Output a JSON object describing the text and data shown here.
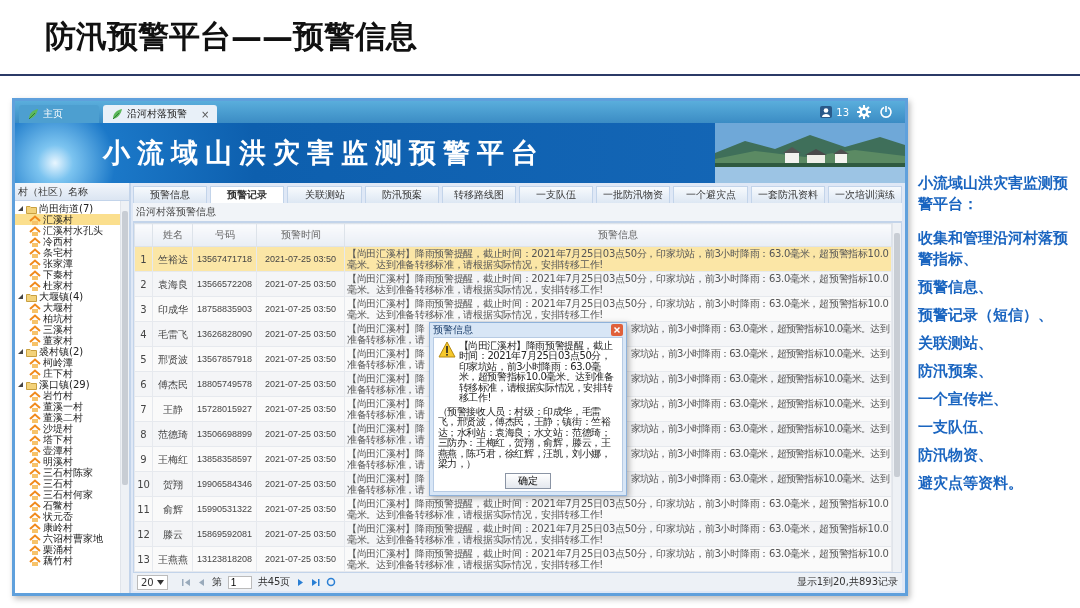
{
  "slide": {
    "title": "防汛预警平台——预警信息",
    "notes": [
      "小流域山洪灾害监测预警平台：",
      "收集和管理沿河村落预警指标、",
      "预警信息、",
      "预警记录（短信）、",
      "关联测站、",
      "防汛预案、",
      "一个宣传栏、",
      "一支队伍、",
      "防汛物资、",
      "避灾点等资料。"
    ]
  },
  "app": {
    "tabs": [
      {
        "label": "主页",
        "selected": false
      },
      {
        "label": "沿河村落预警",
        "selected": true,
        "close": "×"
      }
    ],
    "user_count": "13",
    "banner_title": "小流域山洪灾害监测预警平台",
    "tree": {
      "header": "村（社区）名称",
      "groups": [
        {
          "label": "尚田街道(7)",
          "expanded": true,
          "children": [
            {
              "label": "汇溪村",
              "selected": true
            },
            {
              "label": "汇溪村水孔头",
              "selected": false
            },
            {
              "label": "冷西村",
              "selected": false
            },
            {
              "label": "条宅村",
              "selected": false
            },
            {
              "label": "张家潭",
              "selected": false
            },
            {
              "label": "下秦村",
              "selected": false
            },
            {
              "label": "杜家村",
              "selected": false
            }
          ]
        },
        {
          "label": "大堰镇(4)",
          "expanded": true,
          "children": [
            {
              "label": "大堰村",
              "selected": false
            },
            {
              "label": "柏坑村",
              "selected": false
            },
            {
              "label": "三溪村",
              "selected": false
            },
            {
              "label": "董家村",
              "selected": false
            }
          ]
        },
        {
          "label": "裘村镇(2)",
          "expanded": true,
          "children": [
            {
              "label": "柯岭潭",
              "selected": false
            },
            {
              "label": "庄下村",
              "selected": false
            }
          ]
        },
        {
          "label": "溪口镇(29)",
          "expanded": true,
          "children": [
            {
              "label": "岩竹村",
              "selected": false
            },
            {
              "label": "董溪一村",
              "selected": false
            },
            {
              "label": "董溪二村",
              "selected": false
            },
            {
              "label": "沙堤村",
              "selected": false
            },
            {
              "label": "塔下村",
              "selected": false
            },
            {
              "label": "壶潭村",
              "selected": false
            },
            {
              "label": "明溪村",
              "selected": false
            },
            {
              "label": "三石村陈家",
              "selected": false
            },
            {
              "label": "三石村",
              "selected": false
            },
            {
              "label": "三石村何家",
              "selected": false
            },
            {
              "label": "石鳖村",
              "selected": false
            },
            {
              "label": "状元岙",
              "selected": false
            },
            {
              "label": "康岭村",
              "selected": false
            },
            {
              "label": "六诏村曹家地",
              "selected": false
            },
            {
              "label": "栗涌村",
              "selected": false
            },
            {
              "label": "藕竹村",
              "selected": false
            }
          ]
        }
      ]
    },
    "content_tabs": [
      {
        "label": "预警信息",
        "selected": false
      },
      {
        "label": "预警记录",
        "selected": true
      },
      {
        "label": "关联测站",
        "selected": false
      },
      {
        "label": "防汛预案",
        "selected": false
      },
      {
        "label": "转移路线图",
        "selected": false
      },
      {
        "label": "一支队伍",
        "selected": false
      },
      {
        "label": "一批防汛物资",
        "selected": false
      },
      {
        "label": "一个避灾点",
        "selected": false
      },
      {
        "label": "一套防汛资料",
        "selected": false
      },
      {
        "label": "一次培训演练",
        "selected": false
      }
    ],
    "panel_title": "沿河村落预警信息",
    "table": {
      "columns": [
        "姓名",
        "号码",
        "预警时间",
        "预警信息"
      ],
      "rows": [
        {
          "kind": "full",
          "index": "1",
          "name": "竺裕达",
          "phone": "13567471718",
          "time": "2021-07-25 03:50",
          "message": "【尚田汇溪村】降雨预警提醒，截止时间：2021年7月25日03点50分，印家坑站，前3小时降雨：63.0毫米，超预警指标10.0毫米。达到准备转移标准，请根据实际情况，安排转移工作!",
          "selected": true
        },
        {
          "kind": "full",
          "index": "2",
          "name": "袁海良",
          "phone": "13566572208",
          "time": "2021-07-25 03:50",
          "message": "【尚田汇溪村】降雨预警提醒，截止时间：2021年7月25日03点50分，印家坑站，前3小时降雨：63.0毫米，超预警指标10.0毫米。达到准备转移标准，请根据实际情况，安排转移工作!",
          "selected": false
        },
        {
          "kind": "full",
          "index": "3",
          "name": "印成华",
          "phone": "18758835903",
          "time": "2021-07-25 03:50",
          "message": "【尚田汇溪村】降雨预警提醒，截止时间：2021年7月25日03点50分，印家坑站，前3小时降雨：63.0毫米，超预警指标10.0毫米。达到准备转移标准，请根据实际情况，安排转移工作!",
          "selected": false
        },
        {
          "kind": "covered",
          "index": "4",
          "name": "毛雷飞",
          "phone": "13626828090",
          "time": "2021-07-25 03:50",
          "message_parts": [
            "【尚田汇溪村】降",
            "家坑站，前3小时降雨：63.0毫米，超预警指标10.0毫米。达到",
            "准备转移标准，请"
          ],
          "selected": false
        },
        {
          "kind": "covered",
          "index": "5",
          "name": "邢贤波",
          "phone": "13567857918",
          "time": "2021-07-25 03:50",
          "message_parts": [
            "【尚田汇溪村】降",
            "家坑站，前3小时降雨：63.0毫米，超预警指标10.0毫米。达到",
            "准备转移标准，请"
          ],
          "selected": false
        },
        {
          "kind": "covered",
          "index": "6",
          "name": "傅杰民",
          "phone": "18805749578",
          "time": "2021-07-25 03:50",
          "message_parts": [
            "【尚田汇溪村】降",
            "家坑站，前3小时降雨：63.0毫米，超预警指标10.0毫米。达到",
            "准备转移标准，请"
          ],
          "selected": false
        },
        {
          "kind": "covered",
          "index": "7",
          "name": "王静",
          "phone": "15728015927",
          "time": "2021-07-25 03:50",
          "message_parts": [
            "【尚田汇溪村】降",
            "家坑站，前3小时降雨：63.0毫米，超预警指标10.0毫米。达到",
            "准备转移标准，请"
          ],
          "selected": false
        },
        {
          "kind": "covered",
          "index": "8",
          "name": "范德琦",
          "phone": "13506698899",
          "time": "2021-07-25 03:50",
          "message_parts": [
            "【尚田汇溪村】降",
            "家坑站，前3小时降雨：63.0毫米，超预警指标10.0毫米。达到",
            "准备转移标准，请"
          ],
          "selected": false
        },
        {
          "kind": "covered",
          "index": "9",
          "name": "王梅红",
          "phone": "13858358597",
          "time": "2021-07-25 03:50",
          "message_parts": [
            "【尚田汇溪村】降",
            "家坑站，前3小时降雨：63.0毫米，超预警指标10.0毫米。达到",
            "准备转移标准，请"
          ],
          "selected": false
        },
        {
          "kind": "covered",
          "index": "10",
          "name": "贺翔",
          "phone": "19906584346",
          "time": "2021-07-25 03:50",
          "message_parts": [
            "【尚田汇溪村】降",
            "家坑站，前3小时降雨：63.0毫米，超预警指标10.0毫米。达到",
            "准备转移标准，请"
          ],
          "selected": false
        },
        {
          "kind": "full",
          "index": "11",
          "name": "俞辉",
          "phone": "15990531322",
          "time": "2021-07-25 03:50",
          "message": "【尚田汇溪村】降雨预警提醒，截止时间：2021年7月25日03点50分，印家坑站，前3小时降雨：63.0毫米，超预警指标10.0毫米。达到准备转移标准，请根据实际情况，安排转移工作!",
          "selected": false
        },
        {
          "kind": "full",
          "index": "12",
          "name": "滕云",
          "phone": "15869592081",
          "time": "2021-07-25 03:50",
          "message": "【尚田汇溪村】降雨预警提醒，截止时间：2021年7月25日03点50分，印家坑站，前3小时降雨：63.0毫米，超预警指标10.0毫米。达到准备转移标准，请根据实际情况，安排转移工作!",
          "selected": false
        },
        {
          "kind": "full",
          "index": "13",
          "name": "王燕燕",
          "phone": "13123818208",
          "time": "2021-07-25 03:50",
          "message": "【尚田汇溪村】降雨预警提醒，截止时间：2021年7月25日03点50分，印家坑站，前3小时降雨：63.0毫米，超预警指标10.0毫米。达到准备转移标准，请根据实际情况，安排转移工作!",
          "selected": false
        }
      ]
    },
    "pager": {
      "page_size": "20",
      "page_label": "第",
      "page": "1",
      "total_pages": "共45页",
      "summary": "显示1到20,共893记录"
    },
    "dialog": {
      "title": "预警信息",
      "message": "【尚田汇溪村】降雨预警提醒，截止时间：2021年7月25日03点50分，印家坑站，前3小时降雨：63.0毫米，超预警指标10.0毫米。达到准备转移标准，请根据实际情况，安排转移工作!",
      "recipients": "（预警接收人员：村级：印成华，毛雷飞，邢贤波，傅杰民，王静；镇街：竺裕达；水利站：袁海良；水文站：范德琦；三防办：王梅红，贺翔，俞辉，滕云，王燕燕，陈巧君，徐红辉，汪凯，刘小娜，梁力，）",
      "button": "确定"
    }
  }
}
